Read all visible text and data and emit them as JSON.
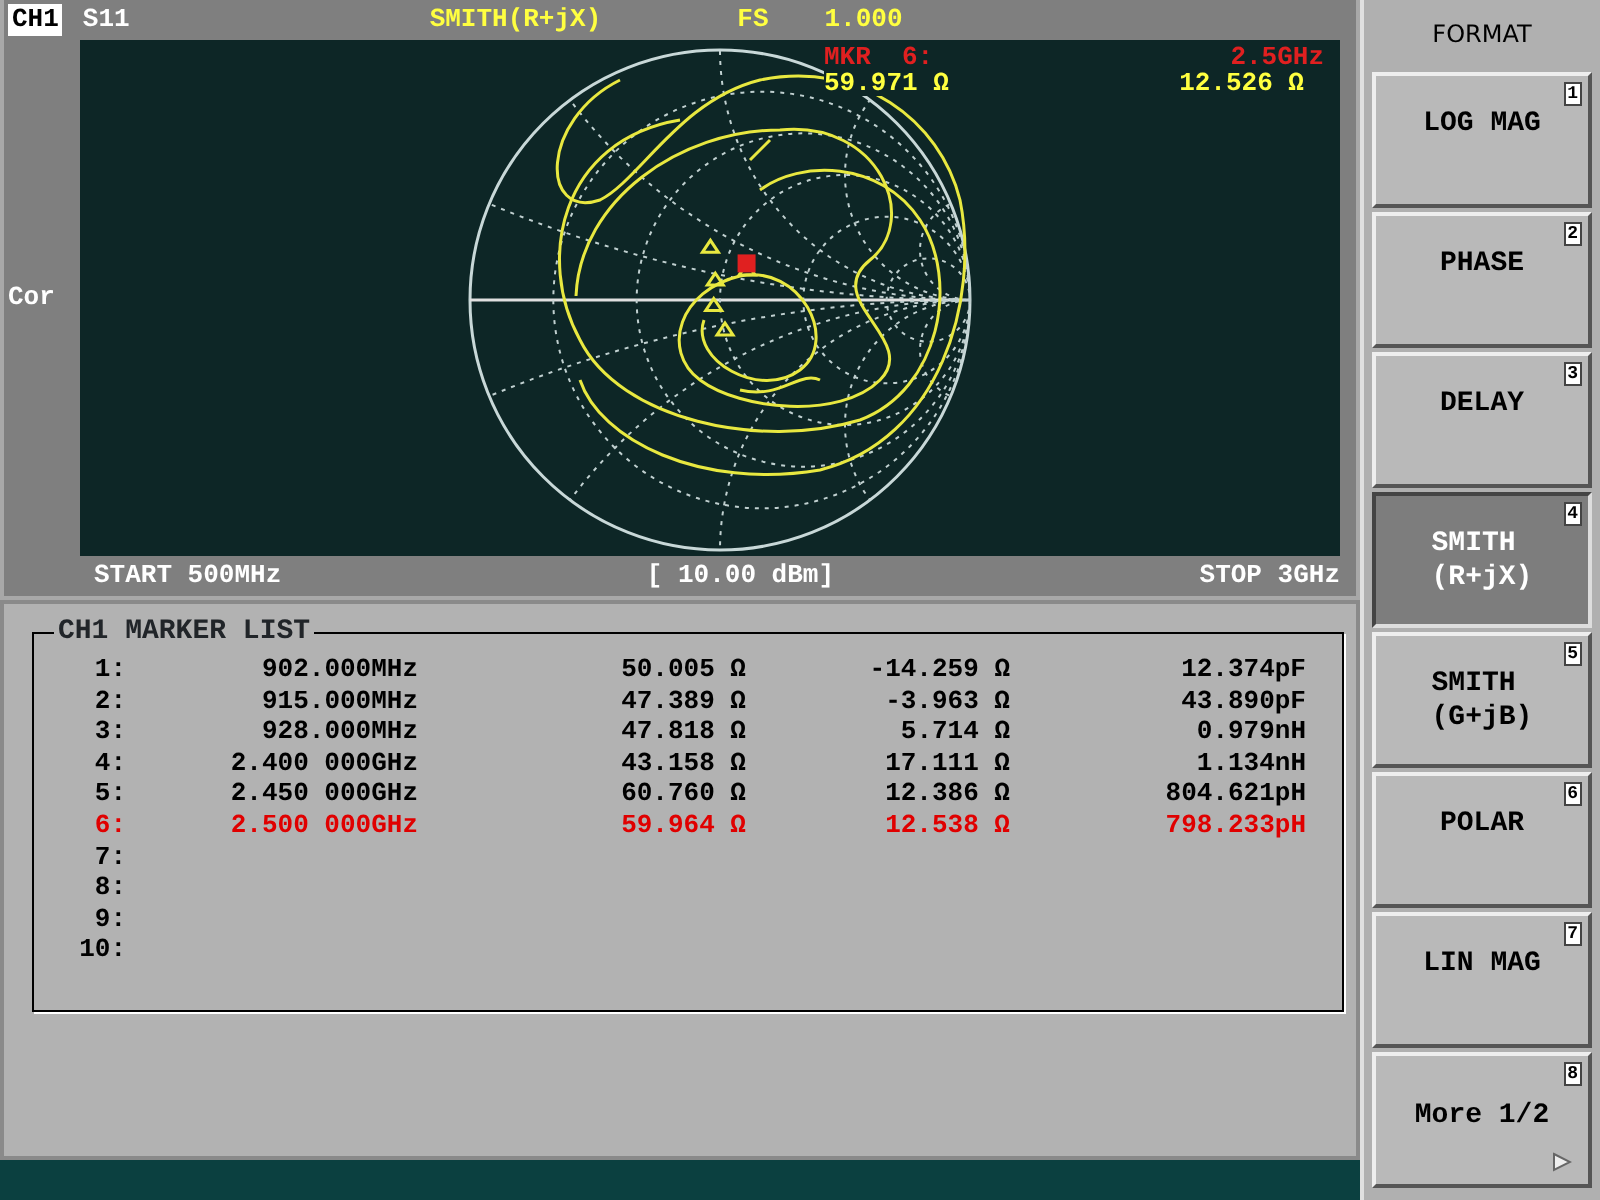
{
  "header": {
    "channel": "CH1",
    "parameter": "S11",
    "format": "SMITH(R+jX)",
    "scale_label": "FS",
    "scale_value": "1.000"
  },
  "marker_readout": {
    "label": "MKR  6:",
    "frequency": "2.5GHz",
    "resistance": "59.971 Ω",
    "reactance": "12.526 Ω"
  },
  "side_label": "Cor",
  "footer": {
    "start": "START 500MHz",
    "power": "[ 10.00 dBm]",
    "stop": "STOP 3GHz"
  },
  "marker_list": {
    "title": "CH1 MARKER LIST",
    "rows": [
      {
        "index": "1:",
        "frequency": "902.000MHz",
        "resistance": "50.005 Ω",
        "reactance": "-14.259 Ω",
        "equivalent": "12.374pF",
        "selected": false
      },
      {
        "index": "2:",
        "frequency": "915.000MHz",
        "resistance": "47.389 Ω",
        "reactance": "-3.963 Ω",
        "equivalent": "43.890pF",
        "selected": false
      },
      {
        "index": "3:",
        "frequency": "928.000MHz",
        "resistance": "47.818 Ω",
        "reactance": "5.714 Ω",
        "equivalent": "0.979nH",
        "selected": false
      },
      {
        "index": "4:",
        "frequency": "2.400 000GHz",
        "resistance": "43.158 Ω",
        "reactance": "17.111 Ω",
        "equivalent": "1.134nH",
        "selected": false
      },
      {
        "index": "5:",
        "frequency": "2.450 000GHz",
        "resistance": "60.760 Ω",
        "reactance": "12.386 Ω",
        "equivalent": "804.621pH",
        "selected": false
      },
      {
        "index": "6:",
        "frequency": "2.500 000GHz",
        "resistance": "59.964 Ω",
        "reactance": "12.538 Ω",
        "equivalent": "798.233pH",
        "selected": true
      },
      {
        "index": "7:",
        "selected": false
      },
      {
        "index": "8:",
        "selected": false
      },
      {
        "index": "9:",
        "selected": false
      },
      {
        "index": "10:",
        "selected": false
      }
    ]
  },
  "menu": {
    "title": "FORMAT",
    "buttons": [
      {
        "lines": [
          "LOG MAG"
        ],
        "number": "1",
        "selected": false,
        "submenu": false
      },
      {
        "lines": [
          "PHASE"
        ],
        "number": "2",
        "selected": false,
        "submenu": false
      },
      {
        "lines": [
          "DELAY"
        ],
        "number": "3",
        "selected": false,
        "submenu": false
      },
      {
        "lines": [
          "SMITH",
          "(R+jX)"
        ],
        "number": "4",
        "selected": true,
        "submenu": false
      },
      {
        "lines": [
          "SMITH",
          "(G+jB)"
        ],
        "number": "5",
        "selected": false,
        "submenu": false
      },
      {
        "lines": [
          "POLAR"
        ],
        "number": "6",
        "selected": false,
        "submenu": false
      },
      {
        "lines": [
          "LIN MAG"
        ],
        "number": "7",
        "selected": false,
        "submenu": false
      },
      {
        "lines": [
          "More 1/2"
        ],
        "number": "8",
        "selected": false,
        "submenu": true
      }
    ]
  }
}
